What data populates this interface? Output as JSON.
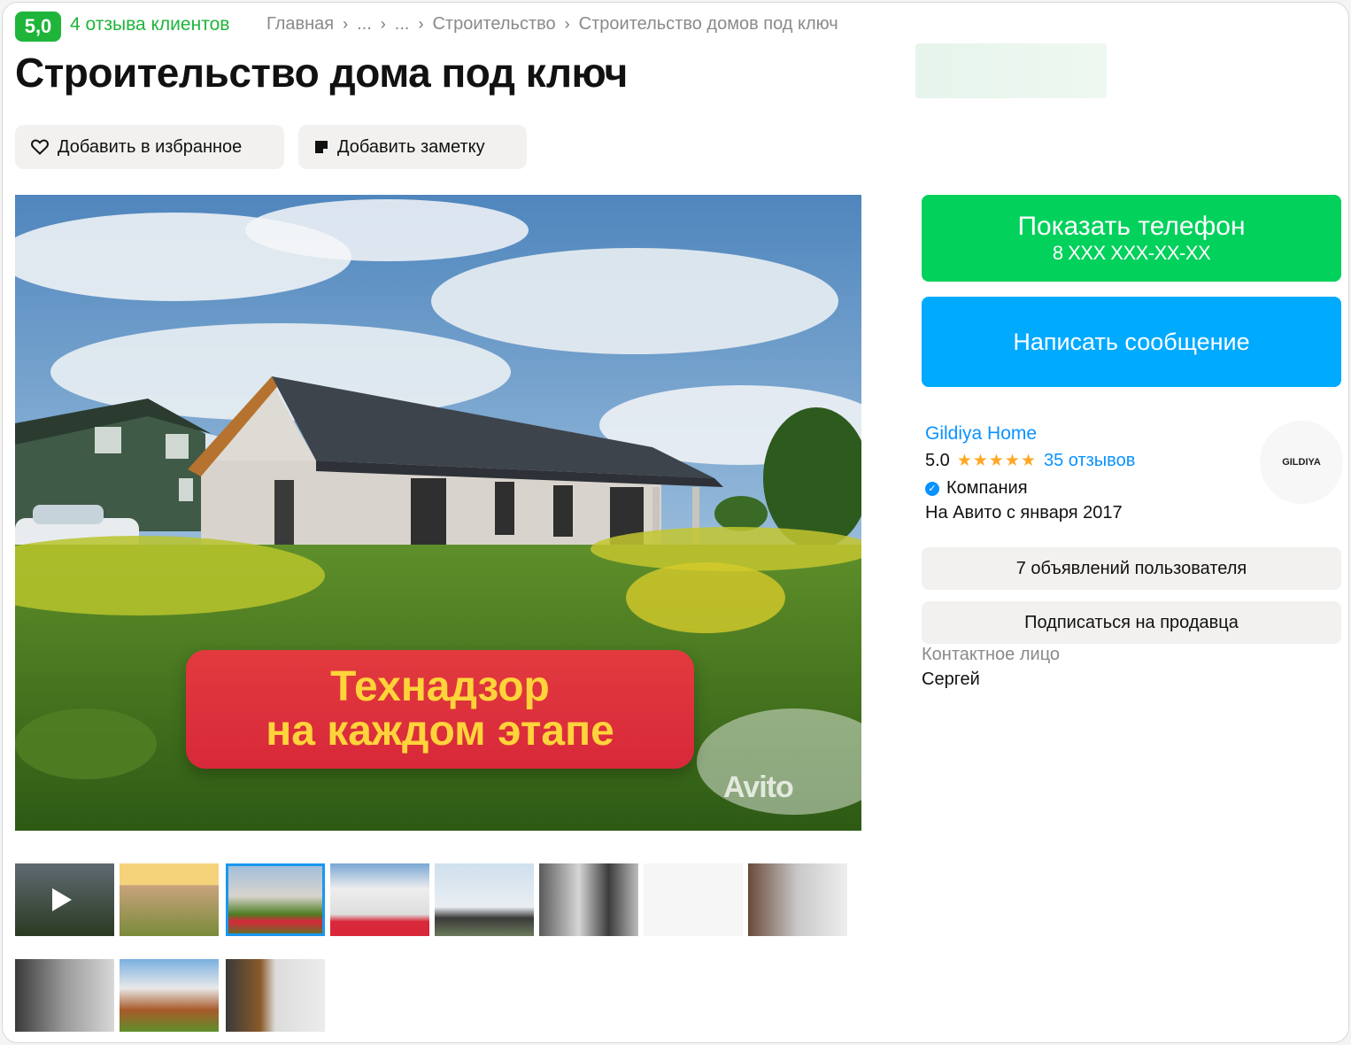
{
  "header": {
    "rating_badge": "5,0",
    "reviews_link": "4 отзыва клиентов",
    "breadcrumb": [
      "Главная",
      "...",
      "...",
      "Строительство",
      "Строительство домов под ключ"
    ]
  },
  "listing": {
    "title": "Строительство дома под ключ",
    "favorite_label": "Добавить в избранное",
    "note_label": "Добавить заметку",
    "banner_line1": "Технадзор",
    "banner_line2": "на каждом этапе",
    "watermark": "Avito",
    "thumbnail_count": 11,
    "selected_thumbnail": 3
  },
  "contact": {
    "phone_button": "Показать телефон",
    "phone_number": "8 XXX XXX-XX-XX",
    "message_button": "Написать сообщение"
  },
  "seller": {
    "name": "Gildiya Home",
    "rating": "5.0",
    "stars": "★★★★★",
    "reviews": "35 отзывов",
    "type": "Компания",
    "since": "На Авито с января 2017",
    "logo_text": "GILDIYA",
    "ads_button": "7 объявлений пользователя",
    "subscribe_button": "Подписаться на продавца",
    "contact_label": "Контактное лицо",
    "contact_name": "Сергей"
  },
  "colors": {
    "green": "#02d15c",
    "blue": "#00aaff",
    "link_blue": "#0a92ff",
    "banner_red": "#e23a3e",
    "banner_yellow": "#ffd43a"
  },
  "icons": [
    "heart-icon",
    "note-icon",
    "chevron-right-icon",
    "play-icon",
    "verified-icon",
    "star-icon"
  ]
}
